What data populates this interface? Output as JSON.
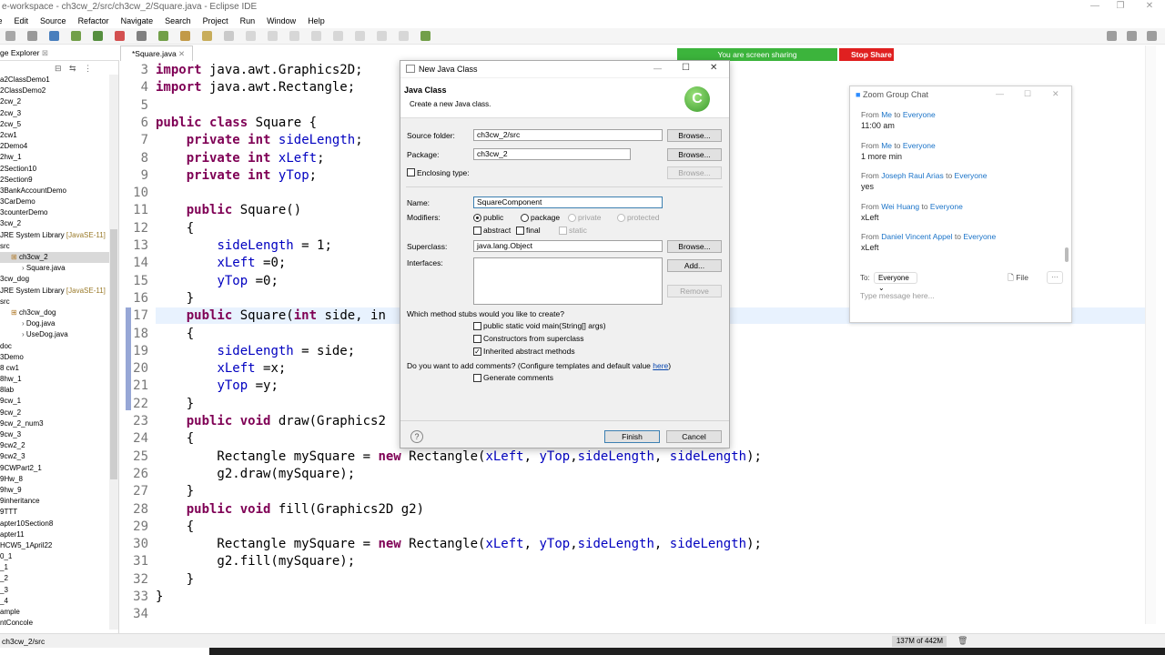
{
  "window": {
    "title": "e-workspace - ch3cw_2/src/ch3cw_2/Square.java - Eclipse IDE"
  },
  "menu": [
    "File",
    "Edit",
    "Source",
    "Refactor",
    "Navigate",
    "Search",
    "Project",
    "Run",
    "Window",
    "Help"
  ],
  "sidebar": {
    "tab_label": "ge Explorer",
    "items": [
      "a2ClassDemo1",
      "2ClassDemo2",
      "2cw_2",
      "2cw_3",
      "2cw_5",
      "2cw1",
      "2Demo4",
      "2hw_1",
      "2Section10",
      "2Section9",
      "3BankAccountDemo",
      "3CarDemo",
      "3counterDemo",
      "3cw_2",
      "JRE System Library",
      "src",
      "ch3cw_2",
      "Square.java",
      "3cw_dog",
      "JRE System Library",
      "src",
      "ch3cw_dog",
      "Dog.java",
      "UseDog.java",
      "doc",
      "3Demo",
      "8 cw1",
      "8hw_1",
      "8lab",
      "9cw_1",
      "9cw_2",
      "9cw_2_num3",
      "9cw_3",
      "9cw2_2",
      "9cw2_3",
      "9CWPart2_1",
      "9Hw_8",
      "9hw_9",
      "9inheritance",
      "9TTT",
      "apter10Section8",
      "apter11",
      "HCW5_1April22",
      "0_1",
      "_1",
      "_2",
      "_3",
      "_4",
      "ample",
      "ntConcole"
    ],
    "jre_suffix": "[JavaSE-11]"
  },
  "editor": {
    "tab_label": "*Square.java",
    "lines": [
      {
        "n": "3",
        "text": "import java.awt.Graphics2D;"
      },
      {
        "n": "4",
        "text": "import java.awt.Rectangle;"
      },
      {
        "n": "5",
        "text": ""
      },
      {
        "n": "6",
        "text": "public class Square {"
      },
      {
        "n": "7",
        "text": "    private int sideLength;"
      },
      {
        "n": "8",
        "text": "    private int xLeft;"
      },
      {
        "n": "9",
        "text": "    private int yTop;"
      },
      {
        "n": "10",
        "text": ""
      },
      {
        "n": "11",
        "text": "    public Square()"
      },
      {
        "n": "12",
        "text": "    {"
      },
      {
        "n": "13",
        "text": "        sideLength = 1;"
      },
      {
        "n": "14",
        "text": "        xLeft =0;"
      },
      {
        "n": "15",
        "text": "        yTop =0;"
      },
      {
        "n": "16",
        "text": "    }"
      },
      {
        "n": "17",
        "text": "    public Square(int side, in"
      },
      {
        "n": "18",
        "text": "    {"
      },
      {
        "n": "19",
        "text": "        sideLength = side;"
      },
      {
        "n": "20",
        "text": "        xLeft =x;"
      },
      {
        "n": "21",
        "text": "        yTop =y;"
      },
      {
        "n": "22",
        "text": "    }"
      },
      {
        "n": "23",
        "text": "    public void draw(Graphics2"
      },
      {
        "n": "24",
        "text": "    {"
      },
      {
        "n": "25",
        "text": "        Rectangle mySquare = new Rectangle(xLeft, yTop,sideLength, sideLength);"
      },
      {
        "n": "26",
        "text": "        g2.draw(mySquare);"
      },
      {
        "n": "27",
        "text": "    }"
      },
      {
        "n": "28",
        "text": "    public void fill(Graphics2D g2)"
      },
      {
        "n": "29",
        "text": "    {"
      },
      {
        "n": "30",
        "text": "        Rectangle mySquare = new Rectangle(xLeft, yTop,sideLength, sideLength);"
      },
      {
        "n": "31",
        "text": "        g2.fill(mySquare);"
      },
      {
        "n": "32",
        "text": "    }"
      },
      {
        "n": "33",
        "text": "}"
      },
      {
        "n": "34",
        "text": ""
      }
    ]
  },
  "status": {
    "path": "ch3cw_2/src",
    "heap": "137M of 442M"
  },
  "sharing": {
    "label": "You are screen sharing",
    "stop": "Stop Share"
  },
  "dialog": {
    "title": "New Java Class",
    "header_title": "Java Class",
    "header_desc": "Create a new Java class.",
    "source_folder_label": "Source folder:",
    "source_folder_value": "ch3cw_2/src",
    "package_label": "Package:",
    "package_value": "ch3cw_2",
    "enclosing_label": "Enclosing type:",
    "browse": "Browse...",
    "name_label": "Name:",
    "name_value": "SquareComponent",
    "modifiers_label": "Modifiers:",
    "mod_public": "public",
    "mod_package": "package",
    "mod_private": "private",
    "mod_protected": "protected",
    "mod_abstract": "abstract",
    "mod_final": "final",
    "mod_static": "static",
    "superclass_label": "Superclass:",
    "superclass_value": "java.lang.Object",
    "interfaces_label": "Interfaces:",
    "add": "Add...",
    "remove": "Remove",
    "stubs_question": "Which method stubs would you like to create?",
    "stub_main": "public static void main(String[] args)",
    "stub_ctor": "Constructors from superclass",
    "stub_inherited": "Inherited abstract methods",
    "comments_question": "Do you want to add comments? (Configure templates and default value ",
    "comments_link": "here",
    "comments_close": ")",
    "gen_comments": "Generate comments",
    "finish": "Finish",
    "cancel": "Cancel",
    "help": "?"
  },
  "chat": {
    "title": "Zoom Group Chat",
    "messages": [
      {
        "from_prefix": "From ",
        "from": "Me",
        "to_prefix": " to ",
        "to": "Everyone",
        "text": "11:00 am"
      },
      {
        "from_prefix": "From ",
        "from": "Me",
        "to_prefix": " to ",
        "to": "Everyone",
        "text": "1 more min"
      },
      {
        "from_prefix": "From ",
        "from": "Joseph Raul Arias",
        "to_prefix": " to ",
        "to": "Everyone",
        "text": "yes"
      },
      {
        "from_prefix": "From ",
        "from": "Wei Huang",
        "to_prefix": " to ",
        "to": "Everyone",
        "text": "xLeft"
      },
      {
        "from_prefix": "From ",
        "from": "Daniel Vincent Appel",
        "to_prefix": " to ",
        "to": "Everyone",
        "text": "xLeft"
      }
    ],
    "to_label": "To:",
    "to_value": "Everyone",
    "file_label": "File",
    "more": "···",
    "input_placeholder": "Type message here..."
  },
  "colors": {
    "keyword": "#7f0055",
    "field": "#0000c0",
    "share_green": "#3cb43c",
    "stop_red": "#e02020",
    "link_blue": "#1a73c8"
  }
}
